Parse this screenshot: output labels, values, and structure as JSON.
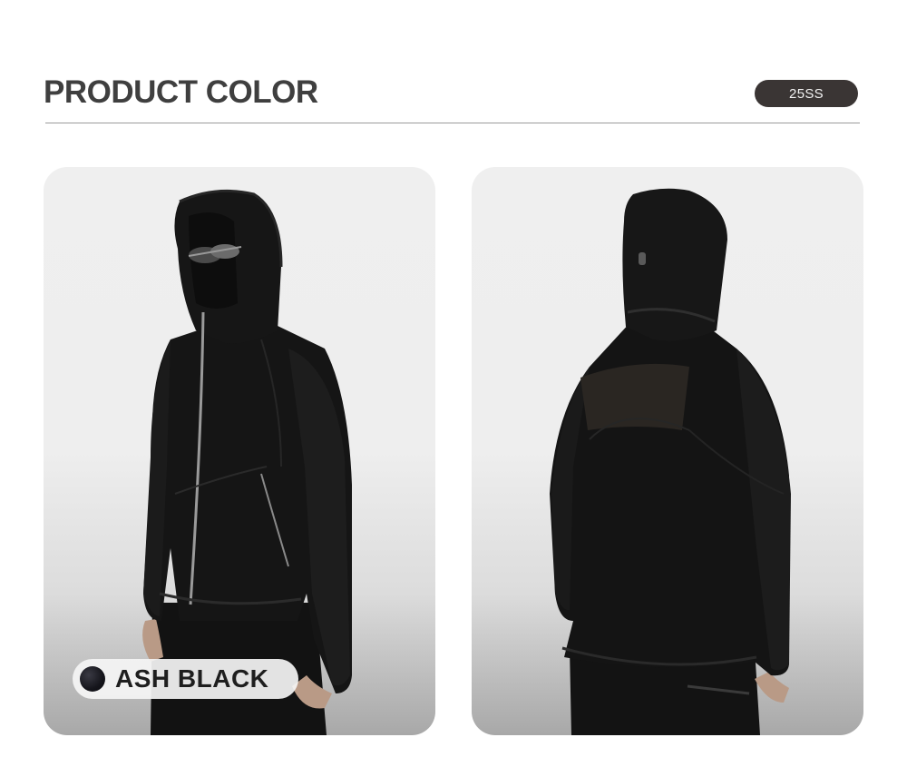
{
  "header": {
    "title": "PRODUCT COLOR",
    "season_badge": "25SS"
  },
  "color_option": {
    "name": "ASH BLACK",
    "swatch_color": "#15151b"
  },
  "photos": {
    "front_view": "jacket-front-view",
    "back_view": "jacket-back-view"
  }
}
